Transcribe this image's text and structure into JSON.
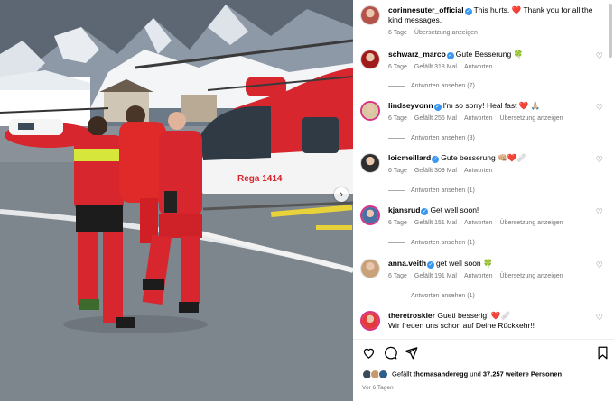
{
  "photo": {
    "helicopter_label": "Rega 1414",
    "next_label": "›"
  },
  "comments": [
    {
      "user": "corinnesuter_official",
      "verified": true,
      "text": "This hurts. ❤️ Thank you for all the kind messages.",
      "meta": [
        "6 Tage",
        "Übersetzung anzeigen"
      ],
      "has_heart": false,
      "avatar_color": "#b5524a"
    },
    {
      "user": "schwarz_marco",
      "verified": true,
      "text": "Gute Besserung 🍀",
      "meta": [
        "6 Tage",
        "Gefällt 318 Mal",
        "Antworten"
      ],
      "replies": "Antworten ansehen (7)",
      "has_heart": true,
      "avatar_color": "#a01c1c"
    },
    {
      "user": "lindseyvonn",
      "verified": true,
      "text": "I'm so sorry! Heal fast ❤️ 🙏🏼",
      "meta": [
        "6 Tage",
        "Gefällt 256 Mal",
        "Antworten",
        "Übersetzung anzeigen"
      ],
      "replies": "Antworten ansehen (3)",
      "has_heart": true,
      "avatar_color": "#d8c7a0"
    },
    {
      "user": "loicmeillard",
      "verified": true,
      "text": "Gute besserung 👊🏼❤️🩹",
      "meta": [
        "6 Tage",
        "Gefällt 309 Mal",
        "Antworten"
      ],
      "replies": "Antworten ansehen (1)",
      "has_heart": true,
      "avatar_color": "#2e2e2e"
    },
    {
      "user": "kjansrud",
      "verified": true,
      "text": "Get well soon!",
      "meta": [
        "6 Tage",
        "Gefällt 151 Mal",
        "Antworten",
        "Übersetzung anzeigen"
      ],
      "replies": "Antworten ansehen (1)",
      "has_heart": true,
      "avatar_color": "#4a6fa5"
    },
    {
      "user": "anna.veith",
      "verified": true,
      "text": "get well soon 🍀",
      "meta": [
        "6 Tage",
        "Gefällt 191 Mal",
        "Antworten",
        "Übersetzung anzeigen"
      ],
      "replies": "Antworten ansehen (1)",
      "has_heart": true,
      "avatar_color": "#c9a27a"
    },
    {
      "user": "theretroskier",
      "verified": false,
      "text": "Gueti besserig! ❤️🩹\nWir freuen uns schon auf Deine Rückkehr!!",
      "meta": [],
      "has_heart": true,
      "avatar_color": "#e33b3b"
    }
  ],
  "actions": {
    "liked_prefix": "Gefällt ",
    "liked_user": "thomasanderegg",
    "liked_mid": " und ",
    "liked_count": "37.257 weitere Personen",
    "timestamp": "Vor 6 Tagen"
  },
  "colors": {
    "accent_blue": "#3897f0",
    "rega_red": "#d7262e",
    "muted": "#737373"
  }
}
